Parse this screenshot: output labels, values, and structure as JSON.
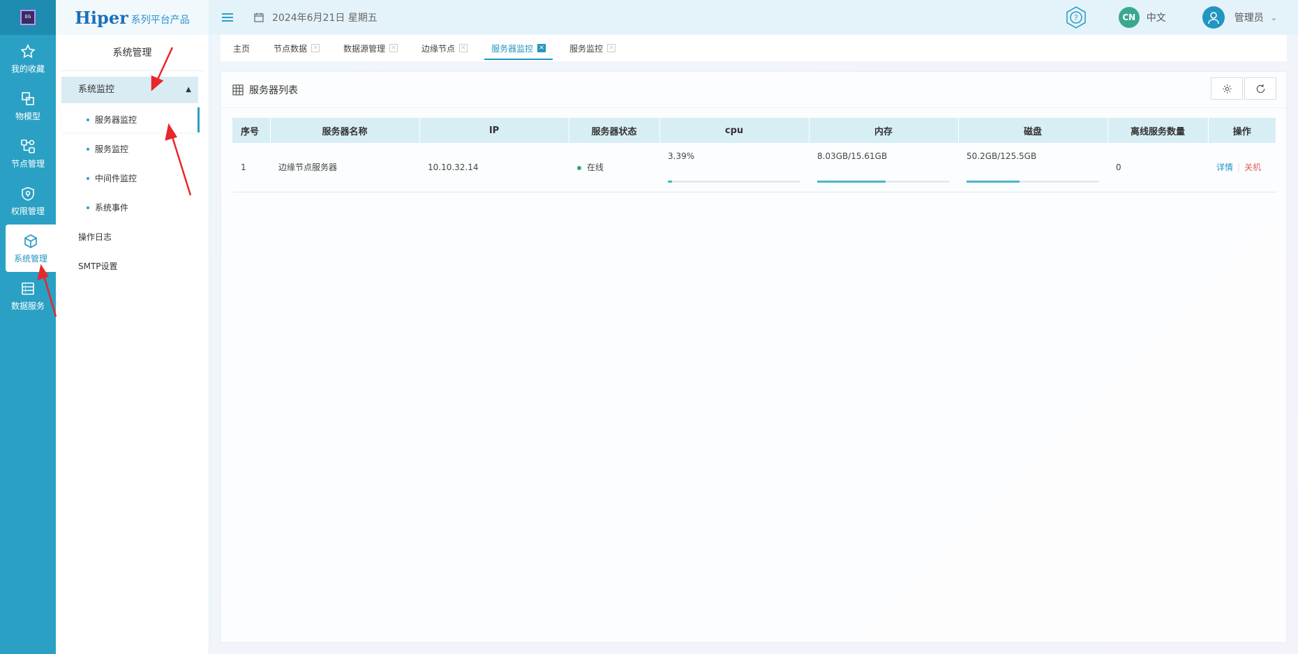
{
  "rail": {
    "logo_text": "EG",
    "items": [
      {
        "label": "我的收藏",
        "icon": "star-icon"
      },
      {
        "label": "物模型",
        "icon": "model-icon"
      },
      {
        "label": "节点管理",
        "icon": "node-icon"
      },
      {
        "label": "权限管理",
        "icon": "shield-icon"
      },
      {
        "label": "系统管理",
        "icon": "cube-icon"
      },
      {
        "label": "数据服务",
        "icon": "database-icon"
      }
    ]
  },
  "brand": {
    "main": "Hiper",
    "sub": "系列平台产品"
  },
  "sidebar": {
    "title": "系统管理",
    "group": "系统监控",
    "sub_items": [
      "服务器监控",
      "服务监控",
      "中间件监控",
      "系统事件"
    ],
    "items": [
      "操作日志",
      "SMTP设置"
    ]
  },
  "topbar": {
    "date": "2024年6月21日 星期五",
    "lang_badge": "CN",
    "lang": "中文",
    "user": "管理员"
  },
  "tabs": [
    {
      "label": "主页",
      "closable": false
    },
    {
      "label": "节点数据",
      "closable": true
    },
    {
      "label": "数据源管理",
      "closable": true
    },
    {
      "label": "边缘节点",
      "closable": true
    },
    {
      "label": "服务器监控",
      "closable": true,
      "active": true
    },
    {
      "label": "服务监控",
      "closable": true
    }
  ],
  "card": {
    "title": "服务器列表"
  },
  "table": {
    "headers": [
      "序号",
      "服务器名称",
      "IP",
      "服务器状态",
      "cpu",
      "内存",
      "磁盘",
      "离线服务数量",
      "操作"
    ],
    "rows": [
      {
        "index": "1",
        "name": "边缘节点服务器",
        "ip": "10.10.32.14",
        "status": "在线",
        "cpu": "3.39%",
        "cpu_frac": 0.0339,
        "mem": "8.03GB/15.61GB",
        "mem_frac": 0.514,
        "disk": "50.2GB/125.5GB",
        "disk_frac": 0.4,
        "offline": "0",
        "op_detail": "详情",
        "op_shutdown": "关机"
      }
    ]
  },
  "colors": {
    "accent": "#2aa0c4",
    "online": "#3aa66e",
    "danger": "#e05a5a"
  }
}
